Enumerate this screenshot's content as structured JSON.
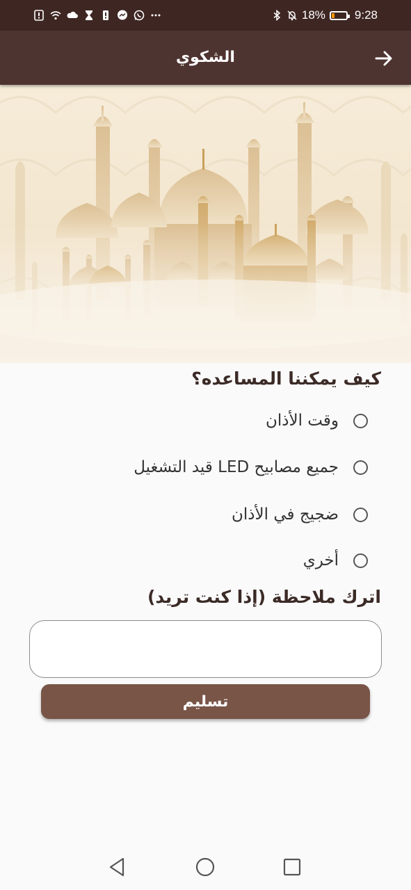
{
  "status_bar": {
    "battery_percent": "18%",
    "time": "9:28",
    "left_icons": [
      "alert-icon",
      "wifi-icon",
      "cloud-icon",
      "hourglass-icon",
      "sim-icon",
      "messenger-icon",
      "whatsapp-icon",
      "more-icon"
    ],
    "right_icons": [
      "bluetooth-icon",
      "bell-off-icon",
      "battery-icon"
    ],
    "battery_level": 0.18,
    "battery_color": "#ff9800"
  },
  "app_bar": {
    "title": "الشكوي",
    "back_icon": "arrow-right-icon",
    "color": "#4e3431"
  },
  "form": {
    "question": "كيف يمكننا المساعده؟",
    "options": [
      {
        "label": "وقت الأذان",
        "selected": false
      },
      {
        "label": "جميع مصابيح LED قيد التشغيل",
        "selected": false
      },
      {
        "label": "ضجيج في الأذان",
        "selected": false
      },
      {
        "label": "أخري",
        "selected": false
      }
    ],
    "note_label": "اترك ملاحظة (إذا كنت تريد)",
    "note_value": "",
    "note_placeholder": "",
    "submit_label": "تسليم",
    "submit_color": "#795548"
  },
  "nav_bar": {
    "icons": [
      "back-triangle-icon",
      "home-circle-icon",
      "recents-square-icon"
    ]
  }
}
